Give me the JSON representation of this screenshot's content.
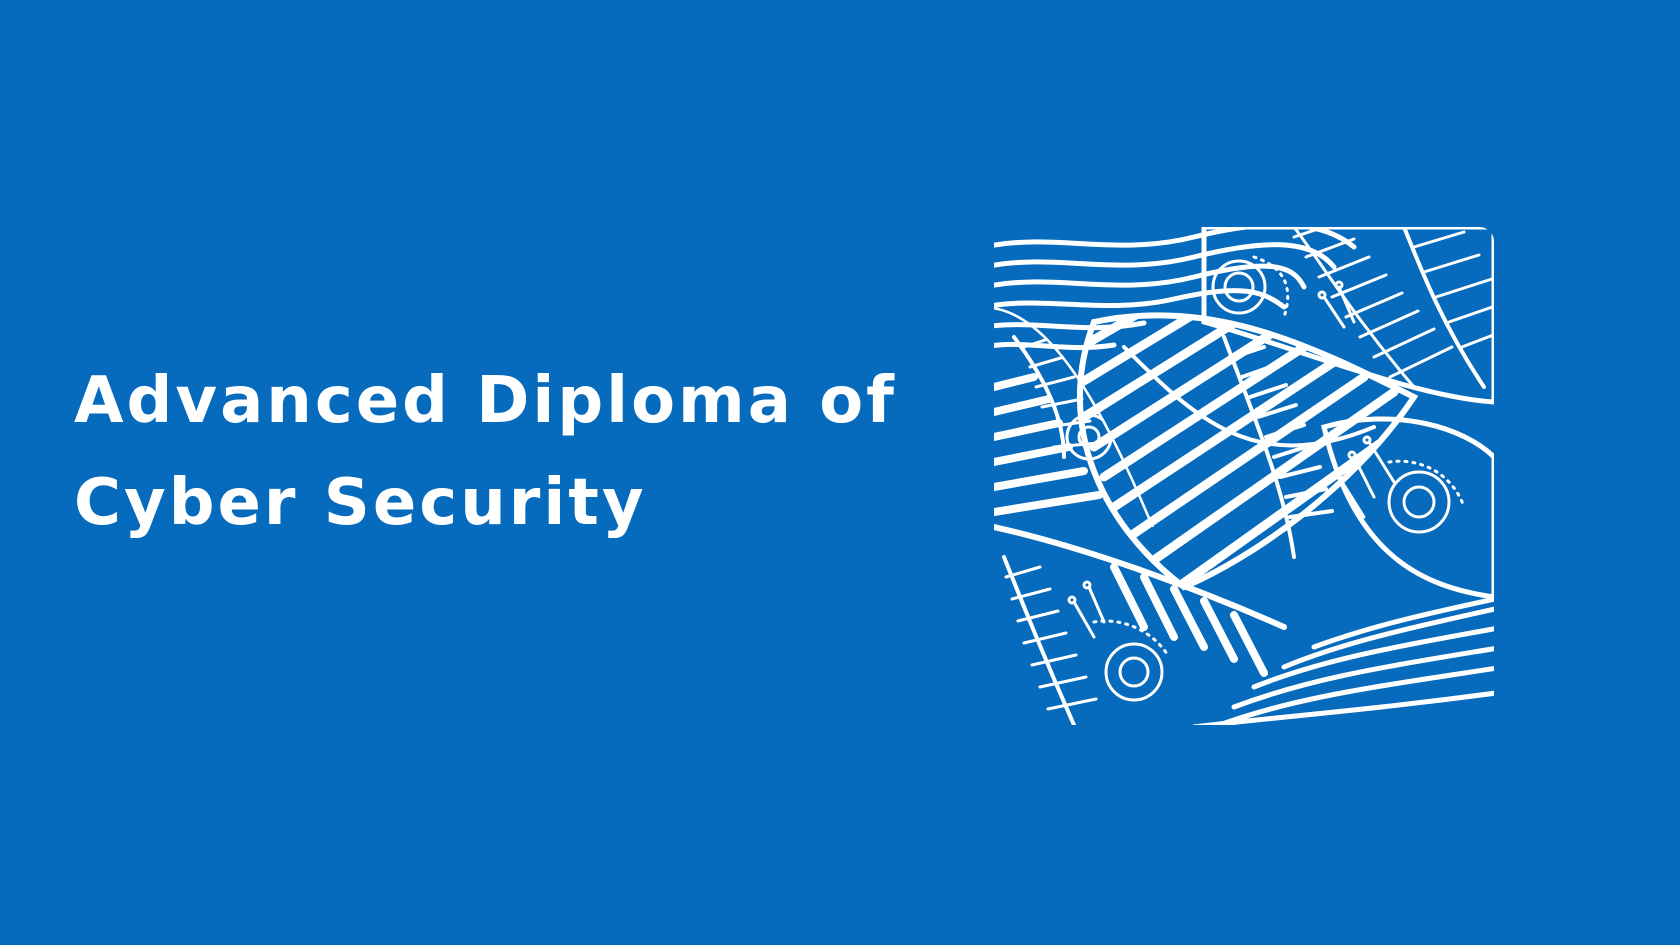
{
  "slide": {
    "background_color": "#066abd",
    "text_color": "#ffffff",
    "title_lines": [
      "Advanced Diploma of",
      "Cyber Security"
    ]
  },
  "artwork": {
    "icon": "abstract-leaf-pattern-icon",
    "line_color": "#ffffff"
  }
}
